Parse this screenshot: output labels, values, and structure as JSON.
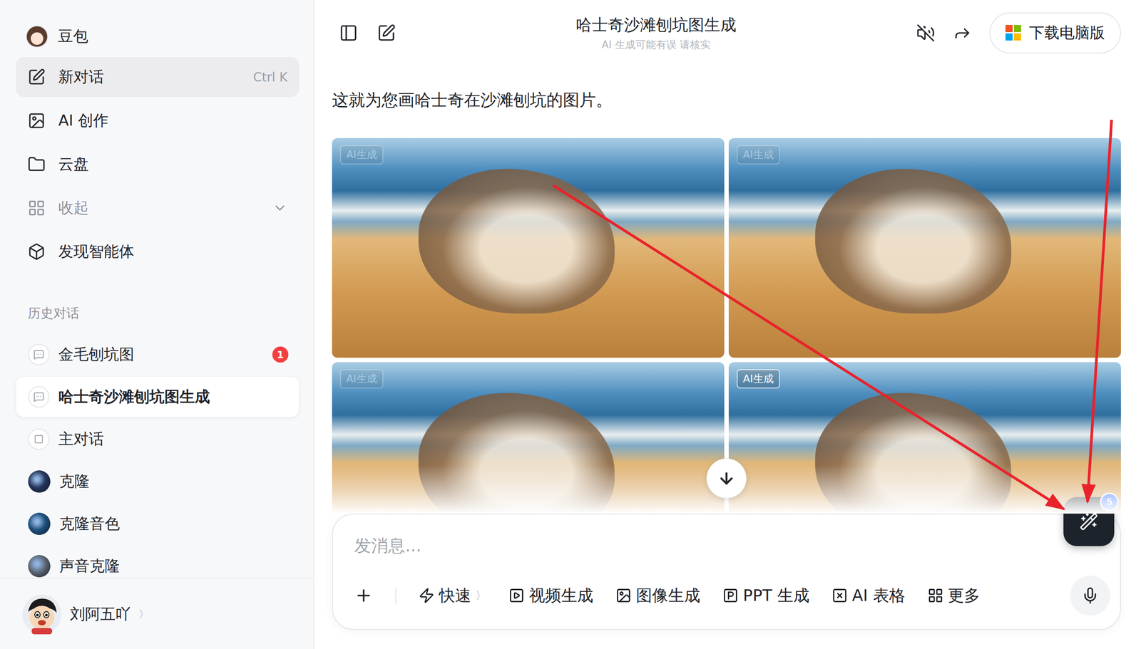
{
  "sidebar": {
    "brand": {
      "name": "豆包"
    },
    "nav": [
      {
        "label": "新对话",
        "shortcut": "Ctrl K",
        "highlighted": true,
        "muted": false,
        "kind": "action"
      },
      {
        "label": "AI 创作",
        "highlighted": false,
        "muted": false,
        "kind": "link"
      },
      {
        "label": "云盘",
        "highlighted": false,
        "muted": false,
        "kind": "link"
      },
      {
        "label": "收起",
        "highlighted": false,
        "muted": true,
        "kind": "toggle",
        "expanded": true
      },
      {
        "label": "发现智能体",
        "highlighted": false,
        "muted": false,
        "kind": "link"
      }
    ],
    "history_title": "历史对话",
    "history": [
      {
        "label": "金毛刨坑图",
        "kind": "chat",
        "selected": false,
        "badge": "1"
      },
      {
        "label": "哈士奇沙滩刨坑图生成",
        "kind": "chat",
        "selected": true
      },
      {
        "label": "主对话",
        "kind": "note",
        "selected": false
      },
      {
        "label": "克隆",
        "kind": "agent",
        "selected": false,
        "color": "#23345a"
      },
      {
        "label": "克隆音色",
        "kind": "agent",
        "selected": false,
        "color": "#1d4f7c"
      },
      {
        "label": "声音克隆",
        "kind": "agent",
        "selected": false,
        "color": "#5d6873"
      }
    ],
    "user": {
      "name": "刘阿五吖",
      "chevron": "〉"
    }
  },
  "header": {
    "title": "哈士奇沙滩刨坑图生成",
    "subtitle": "AI 生成可能有误 请核实",
    "sound_on": false,
    "download": "下载电脑版"
  },
  "chat": {
    "message": "这就为您画哈士奇在沙滩刨坑的图片。",
    "images": [
      {
        "badge": "AI生成",
        "badge_faded": true
      },
      {
        "badge": "AI生成",
        "badge_faded": true
      },
      {
        "badge": "AI生成",
        "badge_faded": true
      },
      {
        "badge": "AI生成",
        "badge_faded": false
      }
    ]
  },
  "composer": {
    "placeholder": "发消息...",
    "tools": [
      {
        "label": "快速",
        "chevron": "〉"
      },
      {
        "label": "视频生成"
      },
      {
        "label": "图像生成"
      },
      {
        "label": "PPT 生成"
      },
      {
        "label": "AI 表格"
      },
      {
        "label": "更多"
      }
    ],
    "assistant_badge": "5"
  }
}
